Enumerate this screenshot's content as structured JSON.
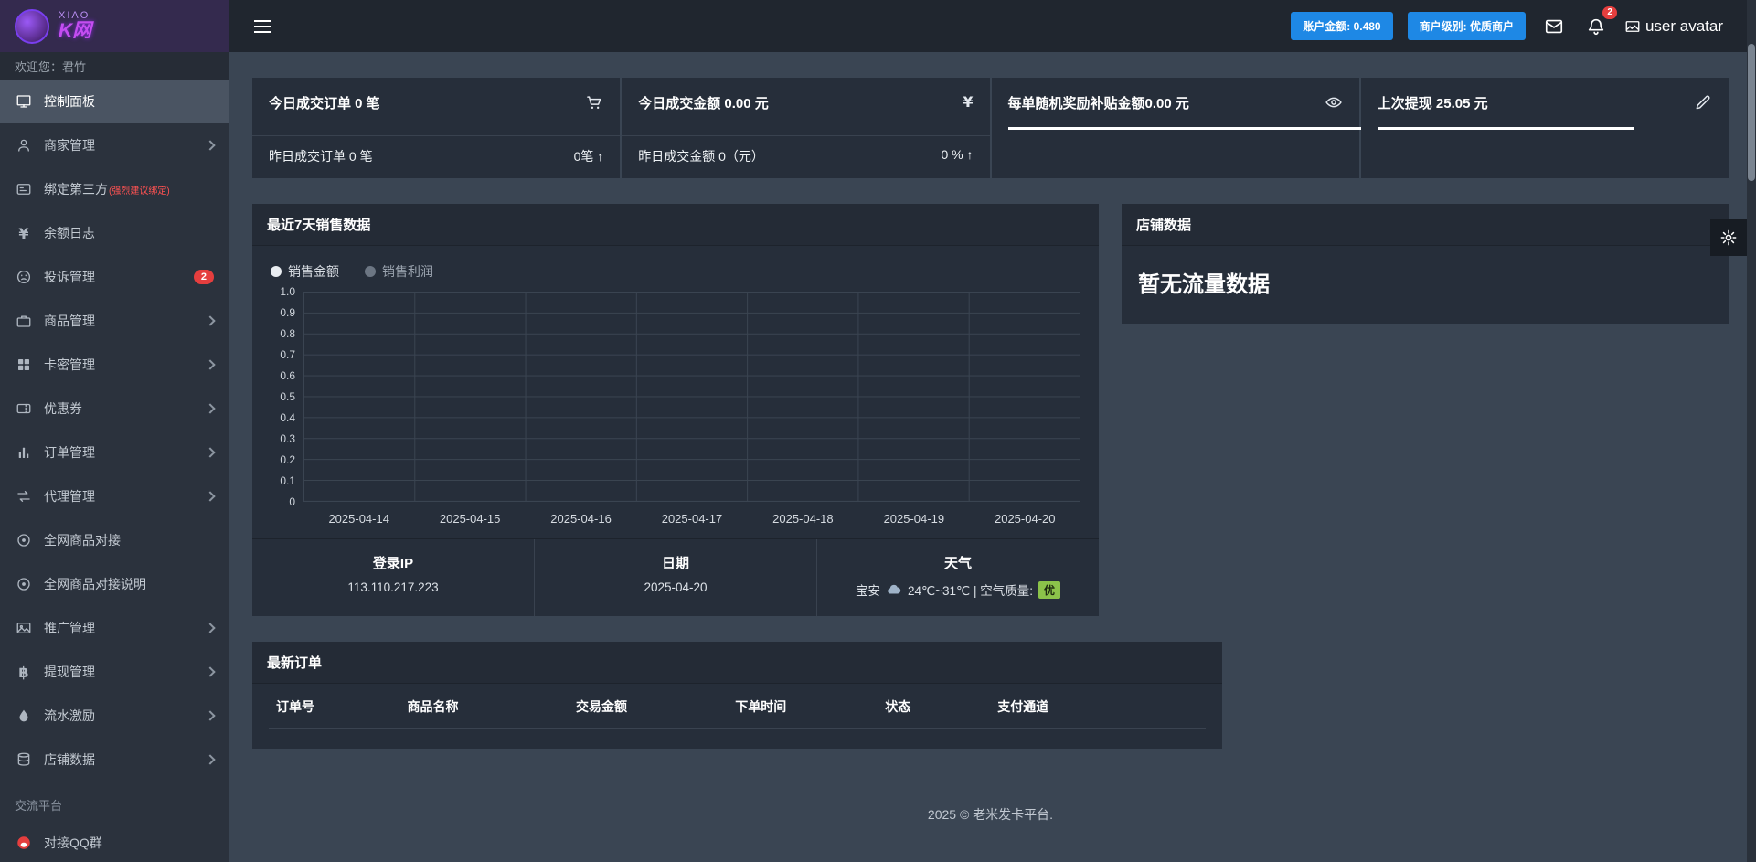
{
  "icons": {
    "yen": "¥",
    "baht": "฿"
  },
  "topbar": {
    "balance_button": "账户金额: 0.480",
    "level_button": "商户级别: 优质商户",
    "bell_badge": "2",
    "avatar_text": "user avatar"
  },
  "sidebar": {
    "logo_line1": "XIAO",
    "logo_line2": "K网",
    "welcome": "欢迎您：君竹",
    "items": [
      {
        "label": "控制面板",
        "icon": "dashboard-icon"
      },
      {
        "label": "商家管理",
        "icon": "merchant-icon"
      },
      {
        "label": "绑定第三方",
        "note": "(强烈建议绑定)",
        "icon": "id-card-icon"
      },
      {
        "label": "余额日志",
        "icon": "yen-icon"
      },
      {
        "label": "投诉管理",
        "badge": "2",
        "icon": "complaint-icon"
      },
      {
        "label": "商品管理",
        "icon": "goods-icon"
      },
      {
        "label": "卡密管理",
        "icon": "cards-grid-icon"
      },
      {
        "label": "优惠券",
        "icon": "coupon-icon"
      },
      {
        "label": "订单管理",
        "icon": "bar-chart-icon"
      },
      {
        "label": "代理管理",
        "icon": "exchange-icon"
      },
      {
        "label": "全网商品对接",
        "icon": "dot-circle-icon"
      },
      {
        "label": "全网商品对接说明",
        "icon": "dot-circle-icon"
      },
      {
        "label": "推广管理",
        "icon": "image-icon"
      },
      {
        "label": "提现管理",
        "icon": "bitcoin-icon"
      },
      {
        "label": "流水激励",
        "icon": "water-drop-icon"
      },
      {
        "label": "店铺数据",
        "icon": "database-icon"
      }
    ],
    "section_label": "交流平台",
    "qq_group": "对接QQ群"
  },
  "stats": [
    {
      "title": "今日成交订单 0 笔",
      "icon": "cart-icon",
      "bottom_left": "昨日成交订单 0 笔",
      "bottom_right": "0笔 ↑"
    },
    {
      "title": "今日成交金额 0.00 元",
      "icon": "yen-icon",
      "bottom_left": "昨日成交金额 0（元）",
      "bottom_right": "0 % ↑"
    },
    {
      "title": "每单随机奖励补贴金额0.00 元",
      "icon": "eye-icon",
      "bar": "100%"
    },
    {
      "title": "上次提现 25.05 元",
      "icon": "pencil-icon",
      "bar": "70%"
    }
  ],
  "chart_data": {
    "type": "line",
    "title": "最近7天销售数据",
    "legend": [
      "销售金额",
      "销售利润"
    ],
    "legend_position": "top-left",
    "x": [
      "2025-04-14",
      "2025-04-15",
      "2025-04-16",
      "2025-04-17",
      "2025-04-18",
      "2025-04-19",
      "2025-04-20"
    ],
    "y_ticks": [
      "1.0",
      "0.9",
      "0.8",
      "0.7",
      "0.6",
      "0.5",
      "0.4",
      "0.3",
      "0.2",
      "0.1",
      "0"
    ],
    "ylim": [
      0,
      1
    ],
    "grid": true,
    "series": [
      {
        "name": "销售金额",
        "values": []
      },
      {
        "name": "销售利润",
        "values": []
      }
    ]
  },
  "info": {
    "ip_label": "登录IP",
    "ip": "113.110.217.223",
    "date_label": "日期",
    "date": "2025-04-20",
    "weather_label": "天气",
    "city": "宝安",
    "detail": "24℃~31℃ | 空气质量:",
    "aqi": "优"
  },
  "shop": {
    "title": "店铺数据",
    "empty": "暂无流量数据"
  },
  "orders": {
    "title": "最新订单",
    "headers": [
      "订单号",
      "商品名称",
      "交易金额",
      "下单时间",
      "状态",
      "支付通道"
    ]
  },
  "footer": "2025 © 老米发卡平台.",
  "colors": {
    "accent_blue": "#1e88e5",
    "badge_red": "#e53e3e",
    "aqi_green": "#8bc34a"
  }
}
